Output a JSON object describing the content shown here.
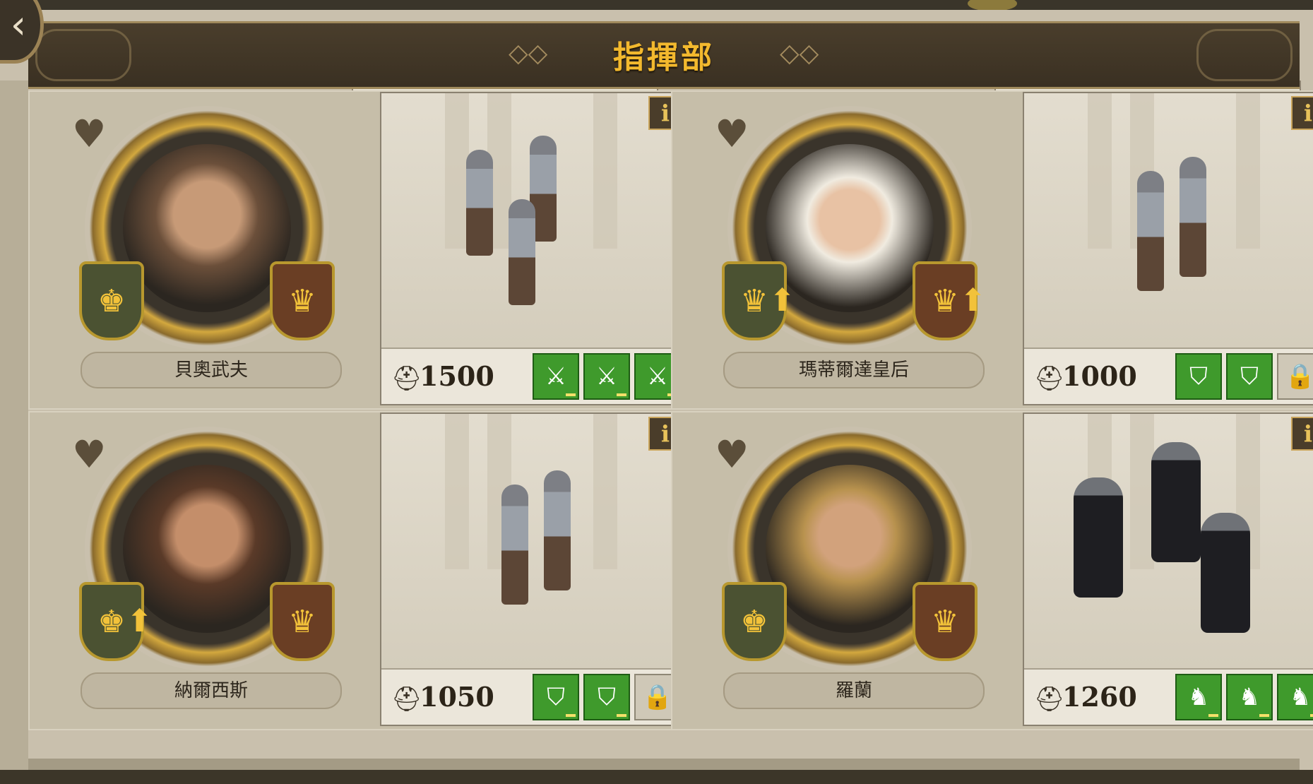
{
  "header": {
    "title": "指揮部",
    "back_icon": "‹"
  },
  "commanders": [
    {
      "name": "貝奧武夫",
      "power": "1500",
      "skills": [
        "crossed-swords",
        "crossed-swords",
        "crossed-swords"
      ],
      "locked_slot": false,
      "upgrade_arrow": false
    },
    {
      "name": "瑪蒂爾達皇后",
      "power": "1000",
      "skills": [
        "shield",
        "shield"
      ],
      "locked_slot": true,
      "upgrade_arrow": true
    },
    {
      "name": "納爾西斯",
      "power": "1050",
      "skills": [
        "shield",
        "shield"
      ],
      "locked_slot": true,
      "upgrade_arrow": true
    },
    {
      "name": "羅蘭",
      "power": "1260",
      "skills": [
        "horse",
        "horse",
        "horse"
      ],
      "locked_slot": false,
      "upgrade_arrow": false
    }
  ],
  "colors": {
    "title": "#f3b92e",
    "skill_active": "#3f9a2c",
    "panel": "#c9c0ad"
  }
}
